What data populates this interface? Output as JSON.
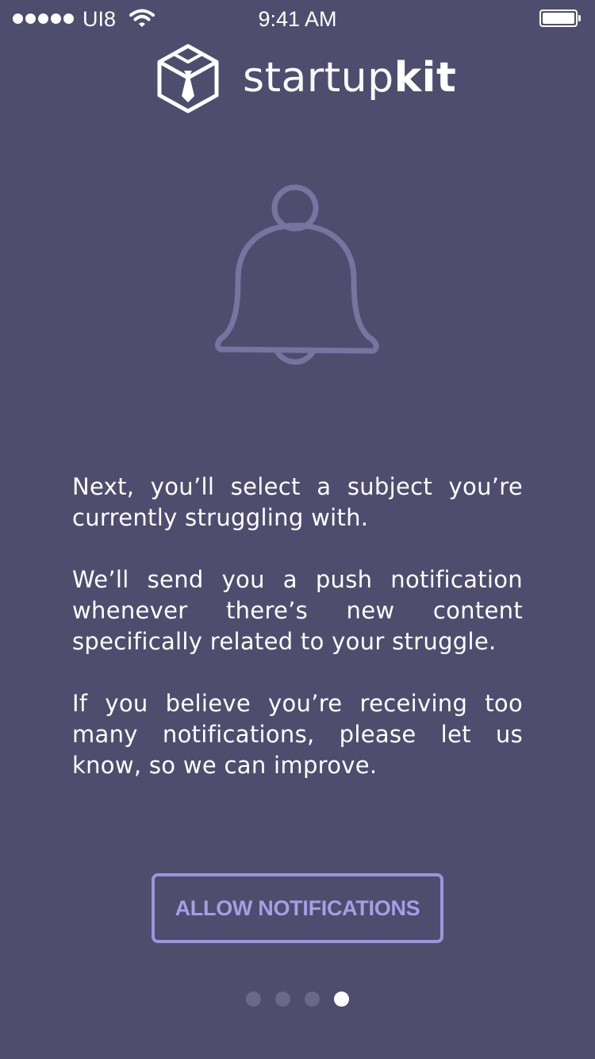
{
  "status_bar": {
    "carrier": "UI8",
    "time": "9:41 AM"
  },
  "logo": {
    "text_light": "startup",
    "text_bold": "kit"
  },
  "hero": {
    "icon": "bell-icon"
  },
  "body": {
    "paragraphs": [
      "Next, you’ll select a subject you’re currently struggling with.",
      "We’ll send you a push notification whenever there’s new content specifically related to your struggle.",
      "If you believe you’re receiving too many notifications, please let us know, so we can improve."
    ]
  },
  "cta": {
    "label": "ALLOW NOTIFICATIONS"
  },
  "pager": {
    "count": 4,
    "active_index": 3
  },
  "colors": {
    "background": "#4f4d6e",
    "accent": "#a59fe3",
    "bell_stroke": "#78739f",
    "inactive_dot": "#6b6987"
  }
}
